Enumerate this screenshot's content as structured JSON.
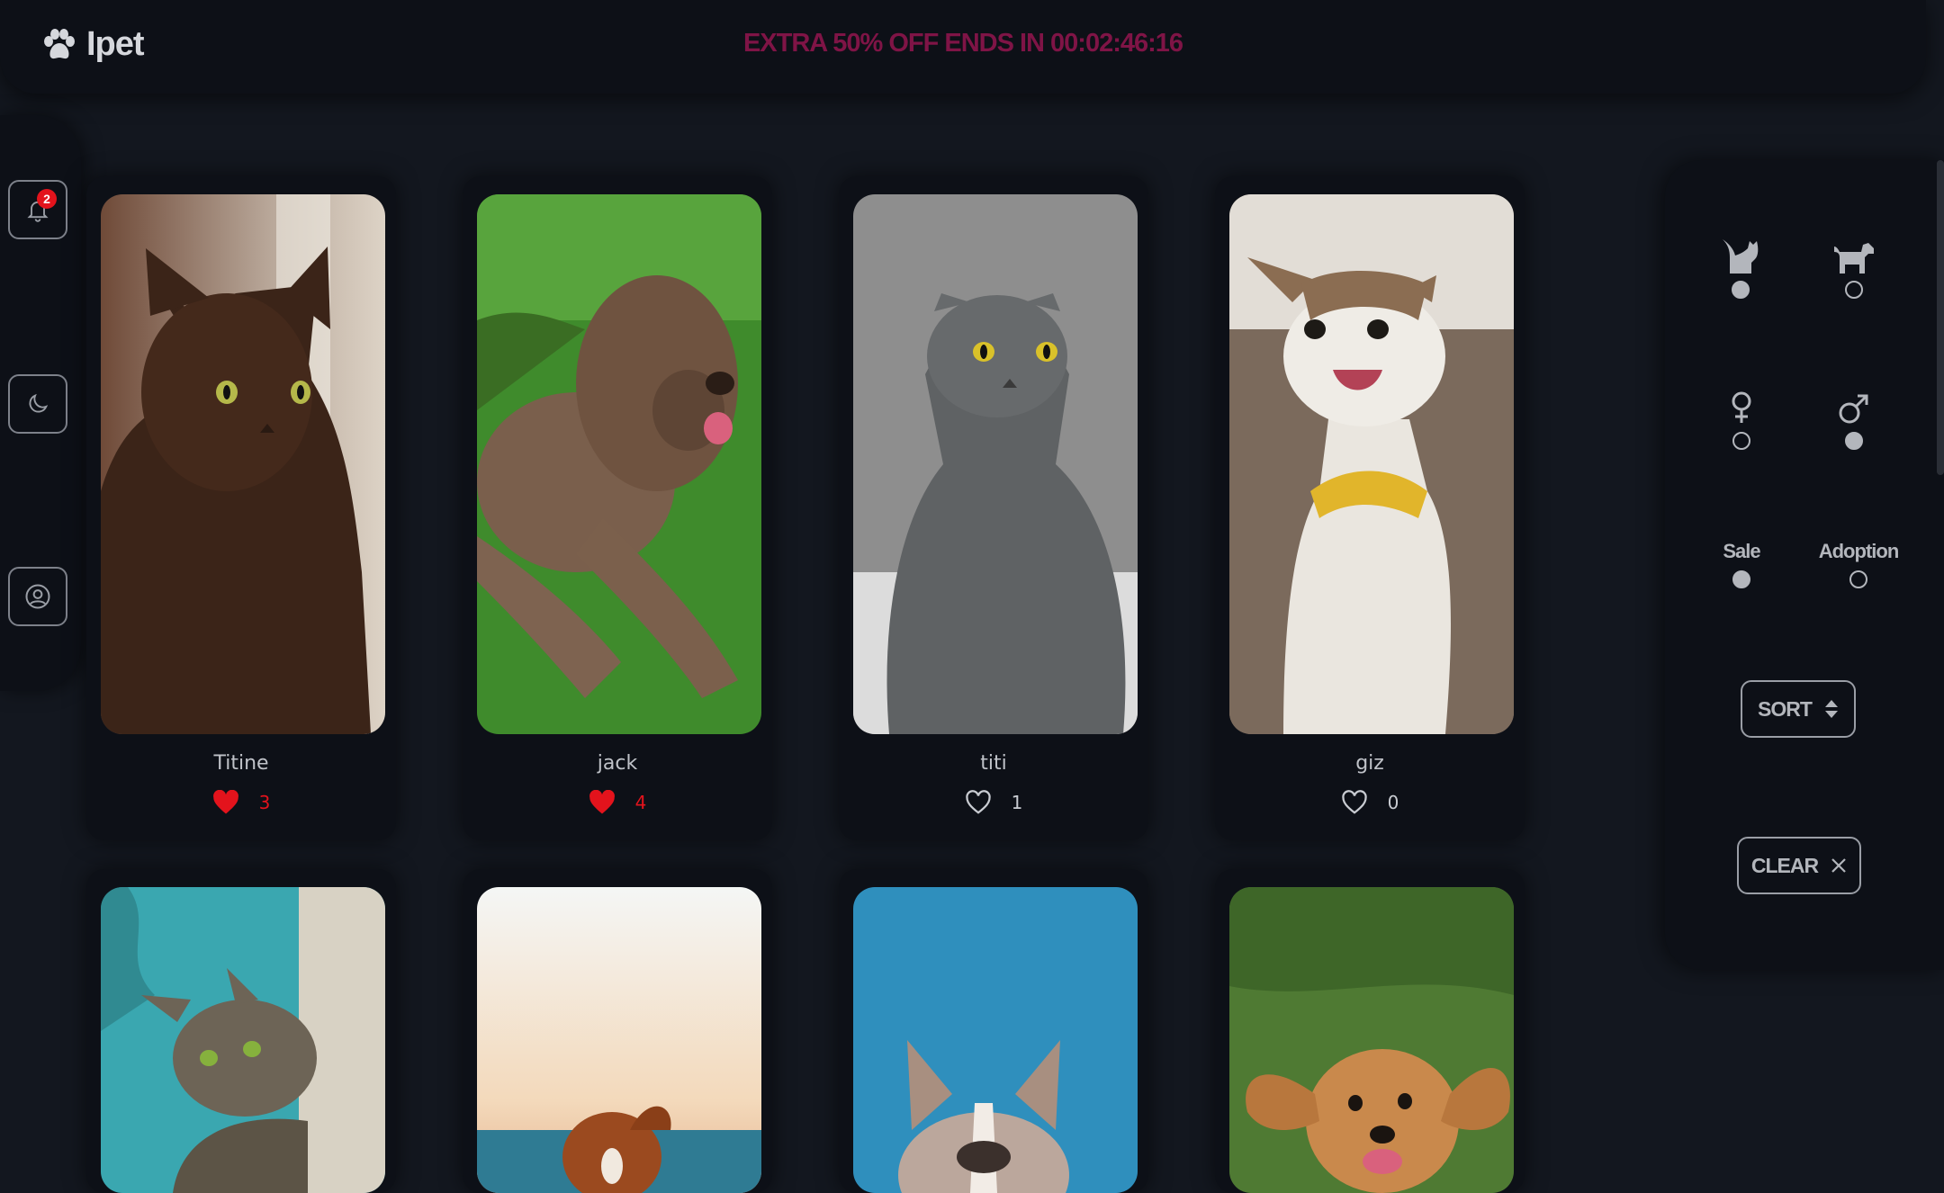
{
  "app": {
    "name": "Ipet",
    "logo_icon": "paw-icon"
  },
  "promo": {
    "text": "EXTRA 50% OFF ENDS IN 00:02:46:16"
  },
  "sidebar": {
    "notifications": {
      "icon": "bell-icon",
      "count": "2"
    },
    "theme": {
      "icon": "moon-icon"
    },
    "profile": {
      "icon": "user-circle-icon"
    }
  },
  "pets": [
    {
      "name": "Titine",
      "likes": "3",
      "liked": true,
      "photo": "brown cat"
    },
    {
      "name": "jack",
      "likes": "4",
      "liked": true,
      "photo": "brown curly dog on grass"
    },
    {
      "name": "titi",
      "likes": "1",
      "liked": false,
      "photo": "grey british shorthair cat"
    },
    {
      "name": "giz",
      "likes": "0",
      "liked": false,
      "photo": "calico cat with yellow bandana"
    },
    {
      "photo": "tabby cat peeking"
    },
    {
      "photo": "dog at beach"
    },
    {
      "photo": "french bulldog on blue"
    },
    {
      "photo": "golden puppy in grass"
    }
  ],
  "filters": {
    "species": [
      {
        "icon": "cat-icon",
        "selected": true
      },
      {
        "icon": "dog-icon",
        "selected": false
      }
    ],
    "gender": [
      {
        "icon": "female-icon",
        "selected": false
      },
      {
        "icon": "male-icon",
        "selected": true
      }
    ],
    "listing": [
      {
        "label": "Sale",
        "selected": true
      },
      {
        "label": "Adoption",
        "selected": false
      }
    ],
    "sort_label": "SORT",
    "clear_label": "CLEAR"
  },
  "colors": {
    "accent_red": "#e3131c",
    "promo": "#7f1446",
    "background": "#13171f",
    "panel": "#0d1017"
  }
}
